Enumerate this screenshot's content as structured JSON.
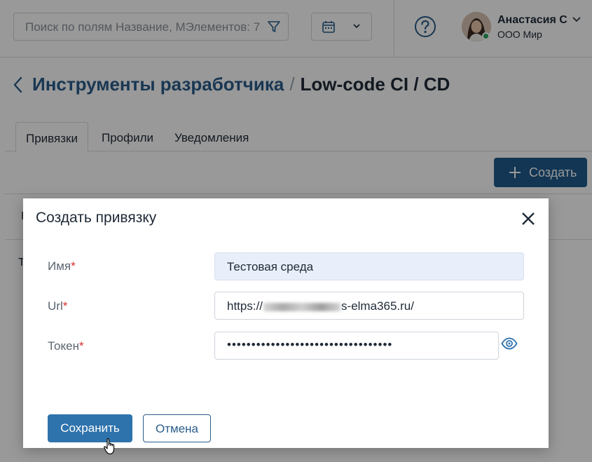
{
  "header": {
    "search_placeholder": "Поиск по полям Название, МЭлементов: 7",
    "user": {
      "name": "Анастасия С",
      "company": "ООО Мир"
    }
  },
  "page": {
    "breadcrumb": {
      "parent": "Инструменты разработчика",
      "separator": "/",
      "current": "Low-code CI / CD"
    },
    "tabs": [
      {
        "label": "Привязки"
      },
      {
        "label": "Профили"
      },
      {
        "label": "Уведомления"
      }
    ],
    "create_button": "Создать",
    "background_fragments": [
      "Н",
      "Т"
    ]
  },
  "modal": {
    "title": "Создать привязку",
    "required_mark": "*",
    "fields": [
      {
        "label": "Имя",
        "value": "Тестовая среда"
      },
      {
        "label": "Url",
        "value_prefix": "https://",
        "value_suffix": "s-elma365.ru/"
      },
      {
        "label": "Токен",
        "value": "••••••••••••••••••••••••••••••••••"
      }
    ],
    "save_button": "Сохранить",
    "cancel_button": "Отмена"
  },
  "colors": {
    "primary": "#1f5a8c",
    "link": "#2b5d8a",
    "required": "#d32f2f",
    "online": "#23a55a"
  }
}
